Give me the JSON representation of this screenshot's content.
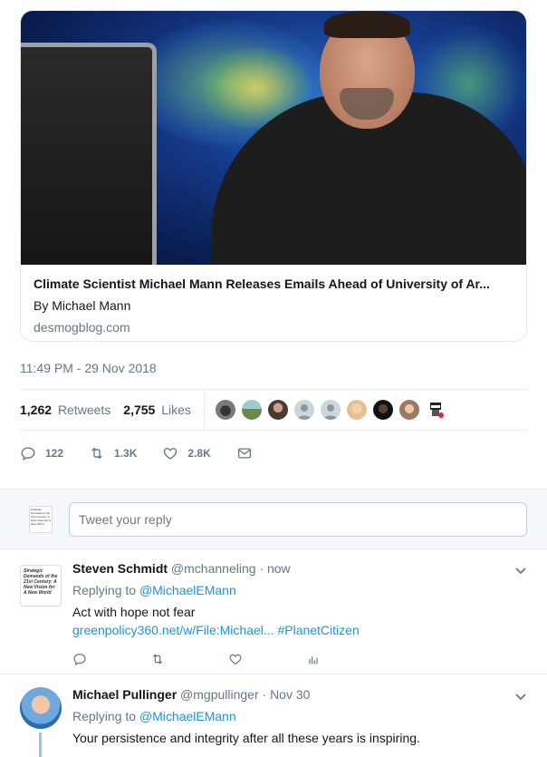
{
  "card": {
    "title": "Climate Scientist Michael Mann Releases Emails Ahead of University of Ar...",
    "author": "By Michael Mann",
    "domain": "desmogblog.com"
  },
  "timestamp": "11:49 PM - 29 Nov 2018",
  "stats": {
    "retweets_count": "1,262",
    "retweets_label": "Retweets",
    "likes_count": "2,755",
    "likes_label": "Likes"
  },
  "actions": {
    "replies": "122",
    "retweets": "1.3K",
    "likes": "2.8K"
  },
  "reply_box": {
    "placeholder": "Tweet your reply",
    "avatar_text": "Strategic Demands of the 21st Century: A New Vision for A New World"
  },
  "replies": [
    {
      "name": "Steven Schmidt",
      "handle": "@mchanneling",
      "time": "· now",
      "replying_prefix": "Replying to",
      "replying_to": "@MichaelEMann",
      "text": "Act with hope not fear",
      "link": "greenpolicy360.net/w/File:Michael...",
      "hashtag": "#PlanetCitizen",
      "avatar_text": "Strategic Demands of the 21st Century: A New Vision for A New World"
    },
    {
      "name": "Michael Pullinger",
      "handle": "@mgpullinger",
      "time": "· Nov 30",
      "replying_prefix": "Replying to",
      "replying_to": "@MichaelEMann",
      "text": "Your persistence and integrity after all these years is inspiring."
    }
  ],
  "colors": {
    "link": "#1b95e0",
    "secondary_text": "#657786",
    "border": "#e6ecf0"
  }
}
